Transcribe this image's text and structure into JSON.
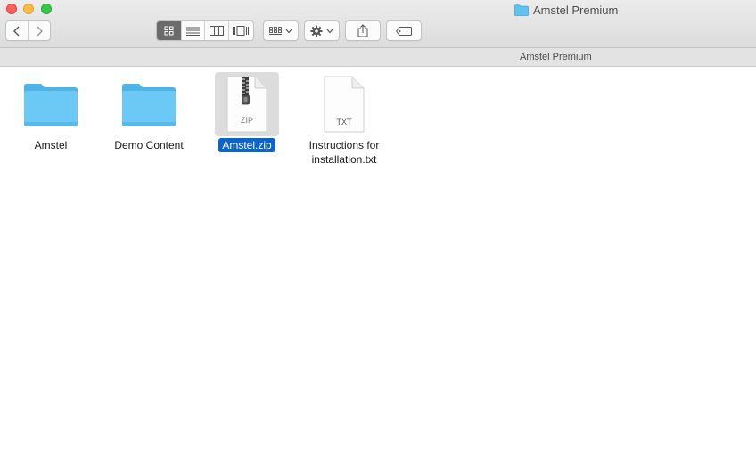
{
  "window": {
    "title": "Amstel Premium"
  },
  "toolbar": {
    "view_buttons": [
      {
        "name": "icon-view",
        "icon": "grid-icon",
        "active": true
      },
      {
        "name": "list-view",
        "icon": "list-icon",
        "active": false
      },
      {
        "name": "column-view",
        "icon": "columns-icon",
        "active": false
      },
      {
        "name": "cover-flow-view",
        "icon": "coverflow-icon",
        "active": false
      }
    ],
    "arrange_icon": "arrange-grid-icon",
    "action_icon": "gear-icon",
    "share_icon": "share-icon",
    "tag_icon": "tag-icon"
  },
  "pathbar": {
    "label": "Amstel Premium"
  },
  "files": [
    {
      "name": "Amstel",
      "type": "folder",
      "selected": false
    },
    {
      "name": "Demo Content",
      "type": "folder",
      "selected": false
    },
    {
      "name": "Amstel.zip",
      "type": "zip",
      "badge": "ZIP",
      "selected": true
    },
    {
      "name": "Instructions for installation.txt",
      "type": "txt",
      "badge": "TXT",
      "selected": false
    }
  ],
  "colors": {
    "folder": "#5fc3f2",
    "selection": "#0b63ce"
  }
}
